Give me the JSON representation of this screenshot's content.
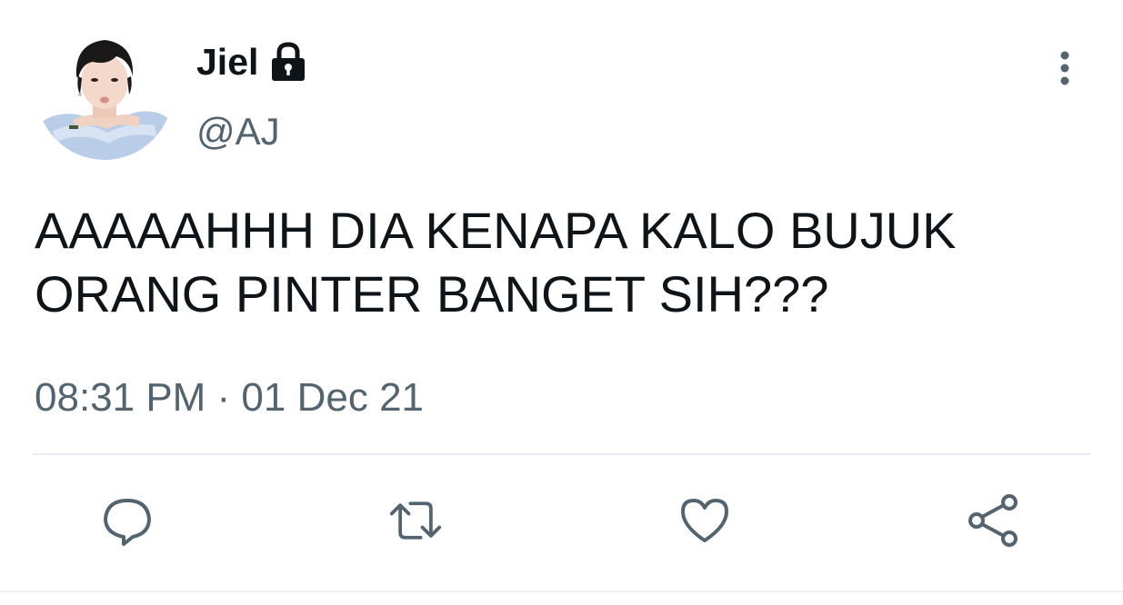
{
  "author": {
    "display_name": "Jiel",
    "handle": "@AJ",
    "protected_icon": "lock-icon",
    "avatar_icon": "avatar"
  },
  "tweet": {
    "text_lines": [
      "AAAAAHHH DIA KENAPA KALO BUJUK",
      "ORANG PINTER BANGET SIH???"
    ],
    "timestamp": "08:31 PM · 01 Dec 21"
  },
  "actions": [
    {
      "name": "reply",
      "icon": "speech-bubble-icon"
    },
    {
      "name": "retweet",
      "icon": "retweet-icon"
    },
    {
      "name": "like",
      "icon": "heart-icon"
    },
    {
      "name": "share",
      "icon": "share-icon"
    }
  ],
  "colors": {
    "text_primary": "#0f1419",
    "text_secondary": "#536471",
    "icon": "#536471",
    "divider": "#e6ecf0"
  }
}
